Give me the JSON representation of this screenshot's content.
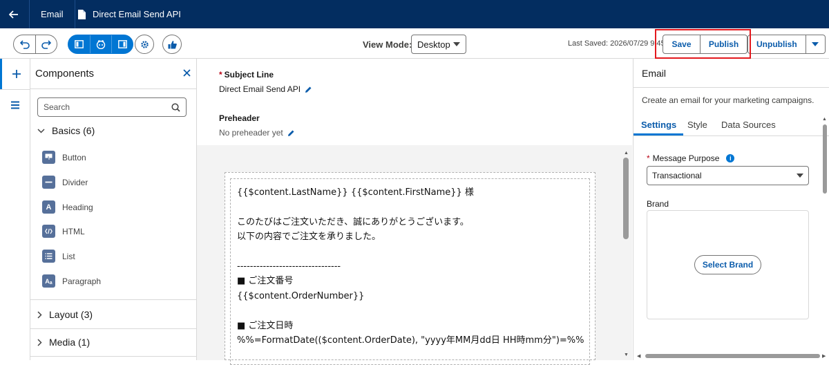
{
  "header": {
    "tab_email": "Email",
    "tab_document": "Direct Email Send API"
  },
  "toolbar": {
    "view_mode_label": "View Mode:",
    "view_mode_value": "Desktop",
    "last_saved": "Last Saved: 2026/07/29 9:45",
    "save_label": "Save",
    "publish_label": "Publish",
    "unpublish_label": "Unpublish"
  },
  "components": {
    "title": "Components",
    "search_placeholder": "Search",
    "groups": [
      {
        "label": "Basics (6)"
      },
      {
        "label": "Layout (3)"
      },
      {
        "label": "Media (1)"
      }
    ],
    "items": [
      {
        "label": "Button",
        "icon": "button-icon"
      },
      {
        "label": "Divider",
        "icon": "divider-icon"
      },
      {
        "label": "Heading",
        "icon": "heading-icon"
      },
      {
        "label": "HTML",
        "icon": "html-icon"
      },
      {
        "label": "List",
        "icon": "list-icon"
      },
      {
        "label": "Paragraph",
        "icon": "paragraph-icon"
      }
    ]
  },
  "email": {
    "subject_label": "Subject Line",
    "subject_value": "Direct Email Send API",
    "preheader_label": "Preheader",
    "preheader_value": "No preheader yet",
    "body_lines": [
      "{{$content.LastName}} {{$content.FirstName}} 様",
      "",
      "このたびはご注文いただき、誠にありがとうございます。",
      "以下の内容でご注文を承りました。",
      "",
      "--------------------------------",
      "■ ご注文番号",
      "{{$content.OrderNumber}}",
      "",
      "■ ご注文日時",
      "%%=FormatDate(($content.OrderDate), \"yyyy年MM月dd日 HH時mm分\")=%%"
    ]
  },
  "properties": {
    "title": "Email",
    "description": "Create an email for your marketing campaigns.",
    "tabs": [
      "Settings",
      "Style",
      "Data Sources"
    ],
    "message_purpose_label": "Message Purpose",
    "message_purpose_value": "Transactional",
    "brand_label": "Brand",
    "select_brand_label": "Select Brand"
  },
  "colors": {
    "header_bg": "#032d60",
    "brand_blue": "#0176d3",
    "highlight_red": "#e3181d"
  }
}
